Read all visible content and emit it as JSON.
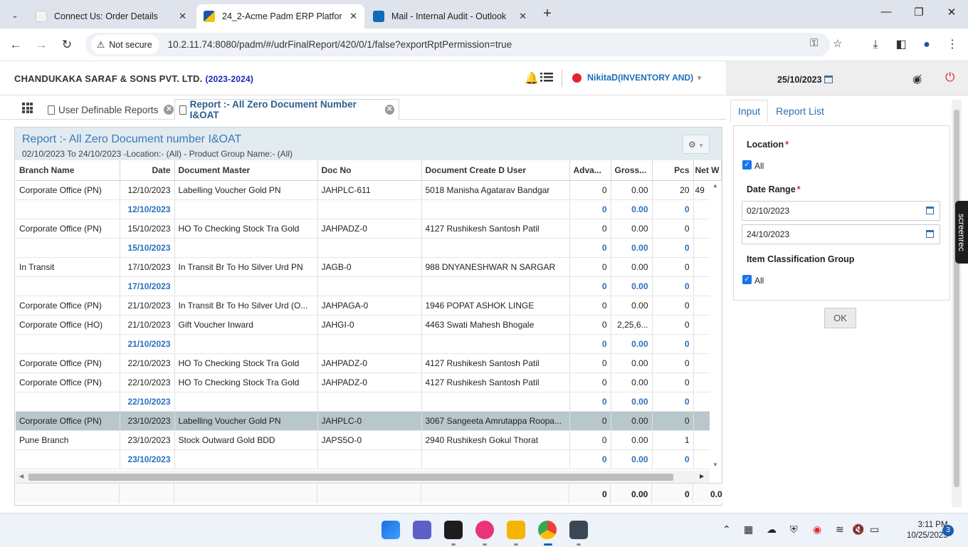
{
  "browser": {
    "tabs": [
      {
        "title": "Connect Us: Order Details",
        "active": false
      },
      {
        "title": "24_2-Acme Padm ERP Platform",
        "active": true
      },
      {
        "title": "Mail - Internal Audit - Outlook",
        "active": false
      }
    ],
    "security": "Not secure",
    "url": "10.2.11.74:8080/padm/#/udrFinalReport/420/0/1/false?exportRptPermission=true"
  },
  "header": {
    "company": "CHANDUKAKA SARAF & SONS PVT. LTD.",
    "year": "(2023-2024)",
    "user": "NikitaD",
    "dept": "(INVENTORY AND)",
    "date": "25/10/2023"
  },
  "apptabs": {
    "tab1": "User Definable Reports",
    "tab2": "Report :- All Zero Document Number I&OAT"
  },
  "report": {
    "title": "Report :- All Zero Document number I&OAT",
    "subtitle": "02/10/2023 To 24/10/2023 -Location:- (All) - Product Group Name:- (All)",
    "columns": [
      "Branch Name",
      "Date",
      "Document Master",
      "Doc No",
      "Document Create D User",
      "Adva...",
      "Gross...",
      "Pcs",
      "Net W"
    ],
    "rows": [
      {
        "type": "data",
        "branch": "Corporate Office (PN)",
        "date": "12/10/2023",
        "master": "Labelling Voucher Gold PN",
        "docno": "JAHPLC-611",
        "user": "5018 Manisha Agatarav Bandgar",
        "adv": "0",
        "gross": "0.00",
        "pcs": "20",
        "net": "49"
      },
      {
        "type": "sub",
        "branch": "",
        "date": "12/10/2023",
        "master": "",
        "docno": "",
        "user": "",
        "adv": "0",
        "gross": "0.00",
        "pcs": "0",
        "net": ""
      },
      {
        "type": "data",
        "branch": "Corporate Office (PN)",
        "date": "15/10/2023",
        "master": "HO To Checking Stock Tra Gold",
        "docno": "JAHPADZ-0",
        "user": "4127 Rushikesh Santosh Patil",
        "adv": "0",
        "gross": "0.00",
        "pcs": "0",
        "net": ""
      },
      {
        "type": "sub",
        "branch": "",
        "date": "15/10/2023",
        "master": "",
        "docno": "",
        "user": "",
        "adv": "0",
        "gross": "0.00",
        "pcs": "0",
        "net": ""
      },
      {
        "type": "data",
        "branch": "In Transit",
        "date": "17/10/2023",
        "master": "In Transit Br To Ho Silver Urd PN",
        "docno": "JAGB-0",
        "user": "988 DNYANESHWAR N SARGAR",
        "adv": "0",
        "gross": "0.00",
        "pcs": "0",
        "net": ""
      },
      {
        "type": "sub",
        "branch": "",
        "date": "17/10/2023",
        "master": "",
        "docno": "",
        "user": "",
        "adv": "0",
        "gross": "0.00",
        "pcs": "0",
        "net": ""
      },
      {
        "type": "data",
        "branch": "Corporate Office (PN)",
        "date": "21/10/2023",
        "master": "In Transit Br To Ho Silver Urd (O...",
        "docno": "JAHPAGA-0",
        "user": "1946 POPAT ASHOK LINGE",
        "adv": "0",
        "gross": "0.00",
        "pcs": "0",
        "net": ""
      },
      {
        "type": "data",
        "branch": "Corporate Office (HO)",
        "date": "21/10/2023",
        "master": "Gift Voucher Inward",
        "docno": "JAHGI-0",
        "user": "4463 Swati Mahesh Bhogale",
        "adv": "0",
        "gross": "2,25,6...",
        "pcs": "0",
        "net": ""
      },
      {
        "type": "sub",
        "branch": "",
        "date": "21/10/2023",
        "master": "",
        "docno": "",
        "user": "",
        "adv": "0",
        "gross": "0.00",
        "pcs": "0",
        "net": ""
      },
      {
        "type": "data",
        "branch": "Corporate Office (PN)",
        "date": "22/10/2023",
        "master": "HO To Checking Stock Tra Gold",
        "docno": "JAHPADZ-0",
        "user": "4127 Rushikesh Santosh Patil",
        "adv": "0",
        "gross": "0.00",
        "pcs": "0",
        "net": ""
      },
      {
        "type": "data",
        "branch": "Corporate Office (PN)",
        "date": "22/10/2023",
        "master": "HO To Checking Stock Tra Gold",
        "docno": "JAHPADZ-0",
        "user": "4127 Rushikesh Santosh Patil",
        "adv": "0",
        "gross": "0.00",
        "pcs": "0",
        "net": ""
      },
      {
        "type": "sub",
        "branch": "",
        "date": "22/10/2023",
        "master": "",
        "docno": "",
        "user": "",
        "adv": "0",
        "gross": "0.00",
        "pcs": "0",
        "net": ""
      },
      {
        "type": "sel",
        "branch": "Corporate Office (PN)",
        "date": "23/10/2023",
        "master": "Labelling Voucher Gold PN",
        "docno": "JAHPLC-0",
        "user": "3067 Sangeeta Amrutappa Roopa...",
        "adv": "0",
        "gross": "0.00",
        "pcs": "0",
        "net": ""
      },
      {
        "type": "data",
        "branch": "Pune Branch",
        "date": "23/10/2023",
        "master": "Stock Outward Gold BDD",
        "docno": "JAPS5O-0",
        "user": "2940 Rushikesh Gokul Thorat",
        "adv": "0",
        "gross": "0.00",
        "pcs": "1",
        "net": ""
      },
      {
        "type": "sub",
        "branch": "",
        "date": "23/10/2023",
        "master": "",
        "docno": "",
        "user": "",
        "adv": "0",
        "gross": "0.00",
        "pcs": "0",
        "net": ""
      }
    ],
    "totals": {
      "adv": "0",
      "gross": "0.00",
      "pcs": "0",
      "net": "0.0"
    }
  },
  "input_panel": {
    "tab_input": "Input",
    "tab_report_list": "Report List",
    "location_label": "Location",
    "location_all": "All",
    "date_range_label": "Date Range",
    "date_from": "02/10/2023",
    "date_to": "24/10/2023",
    "item_group_label": "Item Classification Group",
    "item_all": "All",
    "ok": "OK"
  },
  "screenrec": "screenrec",
  "taskbar": {
    "time": "3:11 PM",
    "date": "10/25/2023",
    "notifications": "3"
  },
  "colors": {
    "accent_blue": "#2a6fc0",
    "selected_row": "#b7c7cc",
    "power_red": "#e0262d"
  }
}
